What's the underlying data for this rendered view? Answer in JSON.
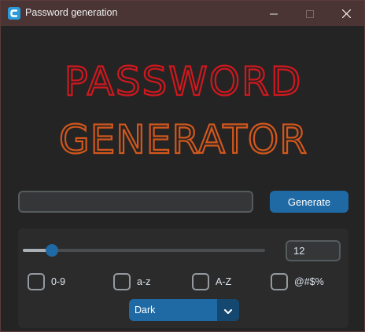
{
  "window": {
    "title": "Password generation",
    "accent": "#1f6aa5",
    "titlebar_color": "#4a3434"
  },
  "icons": {
    "app": "app-logo-icon",
    "minimize": "minimize-icon",
    "maximize": "maximize-icon",
    "close": "close-icon",
    "dropdown": "chevron-down-icon"
  },
  "logo": {
    "line1": "PASSWORD",
    "line2": "GENERATOR",
    "line1_color": "#d0181e",
    "line2_color": "#d2571c"
  },
  "main": {
    "password_value": "",
    "generate_label": "Generate"
  },
  "settings": {
    "length_slider_fraction": 0.12,
    "length_value": "12",
    "checkboxes": [
      {
        "label": "0-9",
        "checked": false
      },
      {
        "label": "a-z",
        "checked": false
      },
      {
        "label": "A-Z",
        "checked": false
      },
      {
        "label": "@#$%",
        "checked": false
      }
    ],
    "theme_selected": "Dark"
  }
}
